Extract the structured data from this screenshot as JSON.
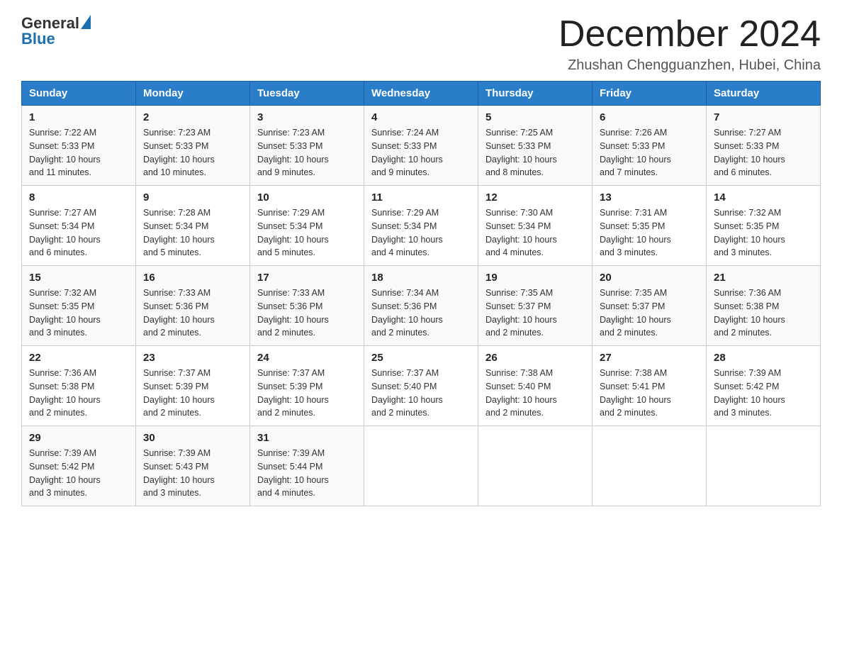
{
  "header": {
    "logo_general": "General",
    "logo_blue": "Blue",
    "month_title": "December 2024",
    "location": "Zhushan Chengguanzhen, Hubei, China"
  },
  "days_of_week": [
    "Sunday",
    "Monday",
    "Tuesday",
    "Wednesday",
    "Thursday",
    "Friday",
    "Saturday"
  ],
  "weeks": [
    [
      {
        "day": "1",
        "sunrise": "7:22 AM",
        "sunset": "5:33 PM",
        "daylight": "10 hours and 11 minutes."
      },
      {
        "day": "2",
        "sunrise": "7:23 AM",
        "sunset": "5:33 PM",
        "daylight": "10 hours and 10 minutes."
      },
      {
        "day": "3",
        "sunrise": "7:23 AM",
        "sunset": "5:33 PM",
        "daylight": "10 hours and 9 minutes."
      },
      {
        "day": "4",
        "sunrise": "7:24 AM",
        "sunset": "5:33 PM",
        "daylight": "10 hours and 9 minutes."
      },
      {
        "day": "5",
        "sunrise": "7:25 AM",
        "sunset": "5:33 PM",
        "daylight": "10 hours and 8 minutes."
      },
      {
        "day": "6",
        "sunrise": "7:26 AM",
        "sunset": "5:33 PM",
        "daylight": "10 hours and 7 minutes."
      },
      {
        "day": "7",
        "sunrise": "7:27 AM",
        "sunset": "5:33 PM",
        "daylight": "10 hours and 6 minutes."
      }
    ],
    [
      {
        "day": "8",
        "sunrise": "7:27 AM",
        "sunset": "5:34 PM",
        "daylight": "10 hours and 6 minutes."
      },
      {
        "day": "9",
        "sunrise": "7:28 AM",
        "sunset": "5:34 PM",
        "daylight": "10 hours and 5 minutes."
      },
      {
        "day": "10",
        "sunrise": "7:29 AM",
        "sunset": "5:34 PM",
        "daylight": "10 hours and 5 minutes."
      },
      {
        "day": "11",
        "sunrise": "7:29 AM",
        "sunset": "5:34 PM",
        "daylight": "10 hours and 4 minutes."
      },
      {
        "day": "12",
        "sunrise": "7:30 AM",
        "sunset": "5:34 PM",
        "daylight": "10 hours and 4 minutes."
      },
      {
        "day": "13",
        "sunrise": "7:31 AM",
        "sunset": "5:35 PM",
        "daylight": "10 hours and 3 minutes."
      },
      {
        "day": "14",
        "sunrise": "7:32 AM",
        "sunset": "5:35 PM",
        "daylight": "10 hours and 3 minutes."
      }
    ],
    [
      {
        "day": "15",
        "sunrise": "7:32 AM",
        "sunset": "5:35 PM",
        "daylight": "10 hours and 3 minutes."
      },
      {
        "day": "16",
        "sunrise": "7:33 AM",
        "sunset": "5:36 PM",
        "daylight": "10 hours and 2 minutes."
      },
      {
        "day": "17",
        "sunrise": "7:33 AM",
        "sunset": "5:36 PM",
        "daylight": "10 hours and 2 minutes."
      },
      {
        "day": "18",
        "sunrise": "7:34 AM",
        "sunset": "5:36 PM",
        "daylight": "10 hours and 2 minutes."
      },
      {
        "day": "19",
        "sunrise": "7:35 AM",
        "sunset": "5:37 PM",
        "daylight": "10 hours and 2 minutes."
      },
      {
        "day": "20",
        "sunrise": "7:35 AM",
        "sunset": "5:37 PM",
        "daylight": "10 hours and 2 minutes."
      },
      {
        "day": "21",
        "sunrise": "7:36 AM",
        "sunset": "5:38 PM",
        "daylight": "10 hours and 2 minutes."
      }
    ],
    [
      {
        "day": "22",
        "sunrise": "7:36 AM",
        "sunset": "5:38 PM",
        "daylight": "10 hours and 2 minutes."
      },
      {
        "day": "23",
        "sunrise": "7:37 AM",
        "sunset": "5:39 PM",
        "daylight": "10 hours and 2 minutes."
      },
      {
        "day": "24",
        "sunrise": "7:37 AM",
        "sunset": "5:39 PM",
        "daylight": "10 hours and 2 minutes."
      },
      {
        "day": "25",
        "sunrise": "7:37 AM",
        "sunset": "5:40 PM",
        "daylight": "10 hours and 2 minutes."
      },
      {
        "day": "26",
        "sunrise": "7:38 AM",
        "sunset": "5:40 PM",
        "daylight": "10 hours and 2 minutes."
      },
      {
        "day": "27",
        "sunrise": "7:38 AM",
        "sunset": "5:41 PM",
        "daylight": "10 hours and 2 minutes."
      },
      {
        "day": "28",
        "sunrise": "7:39 AM",
        "sunset": "5:42 PM",
        "daylight": "10 hours and 3 minutes."
      }
    ],
    [
      {
        "day": "29",
        "sunrise": "7:39 AM",
        "sunset": "5:42 PM",
        "daylight": "10 hours and 3 minutes."
      },
      {
        "day": "30",
        "sunrise": "7:39 AM",
        "sunset": "5:43 PM",
        "daylight": "10 hours and 3 minutes."
      },
      {
        "day": "31",
        "sunrise": "7:39 AM",
        "sunset": "5:44 PM",
        "daylight": "10 hours and 4 minutes."
      },
      null,
      null,
      null,
      null
    ]
  ],
  "labels": {
    "sunrise": "Sunrise:",
    "sunset": "Sunset:",
    "daylight": "Daylight:"
  }
}
